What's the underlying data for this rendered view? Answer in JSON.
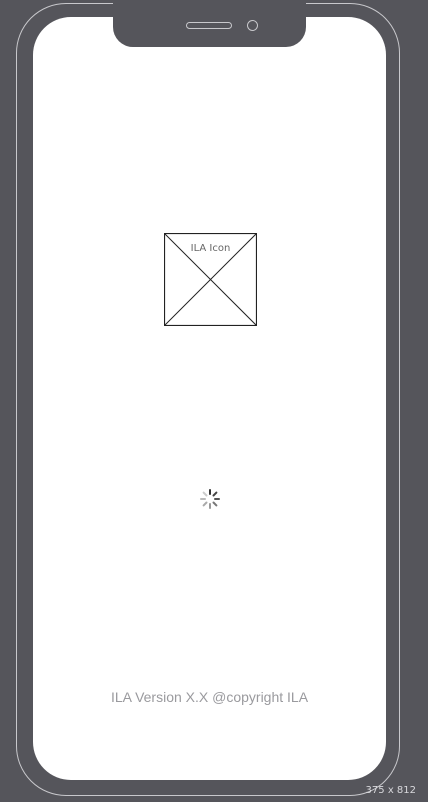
{
  "app_icon": {
    "label": "ILA Icon"
  },
  "footer": {
    "text": "ILA Version X.X @copyright ILA"
  },
  "device": {
    "size_label": "375 x 812"
  }
}
